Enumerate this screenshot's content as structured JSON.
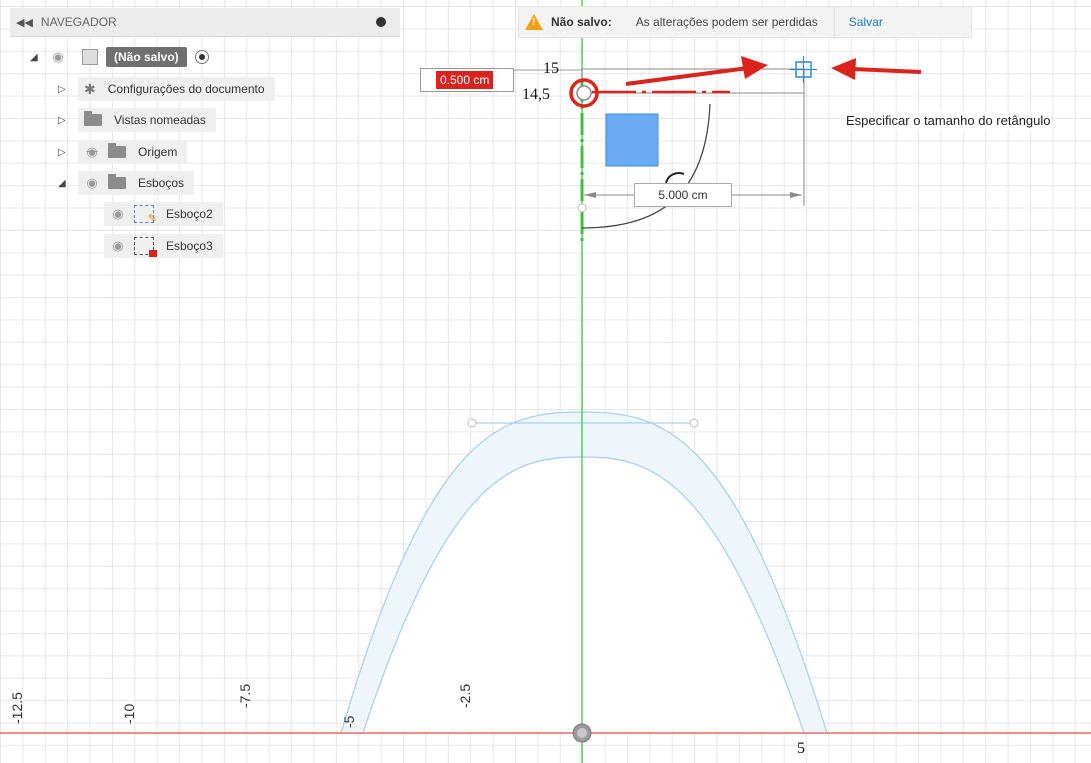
{
  "navigator": {
    "title": "NAVEGADOR",
    "root_label": "(Não salvo)",
    "items": [
      {
        "label": "Configurações do documento"
      },
      {
        "label": "Vistas nomeadas"
      },
      {
        "label": "Origem"
      },
      {
        "label": "Esboços"
      },
      {
        "label": "Esboço2"
      },
      {
        "label": "Esboço3"
      }
    ]
  },
  "banner": {
    "title": "Não salvo:",
    "message": "As alterações podem ser perdidas",
    "save_label": "Salvar"
  },
  "sketch": {
    "input_value": "0.500 cm",
    "dimension_label": "5.000 cm",
    "tooltip": "Especificar o tamanho do retângulo",
    "annotations": {
      "top": "15",
      "side": "14,5",
      "bottom": "5"
    },
    "axis_ticks": [
      "-12.5",
      "-10",
      "-7.5",
      "-5",
      "-2.5"
    ]
  },
  "colors": {
    "accent": "#d9231c",
    "sketch_blue": "#2a8ad8",
    "axis_green": "#3cc23c",
    "axis_red": "#e86a6a"
  }
}
